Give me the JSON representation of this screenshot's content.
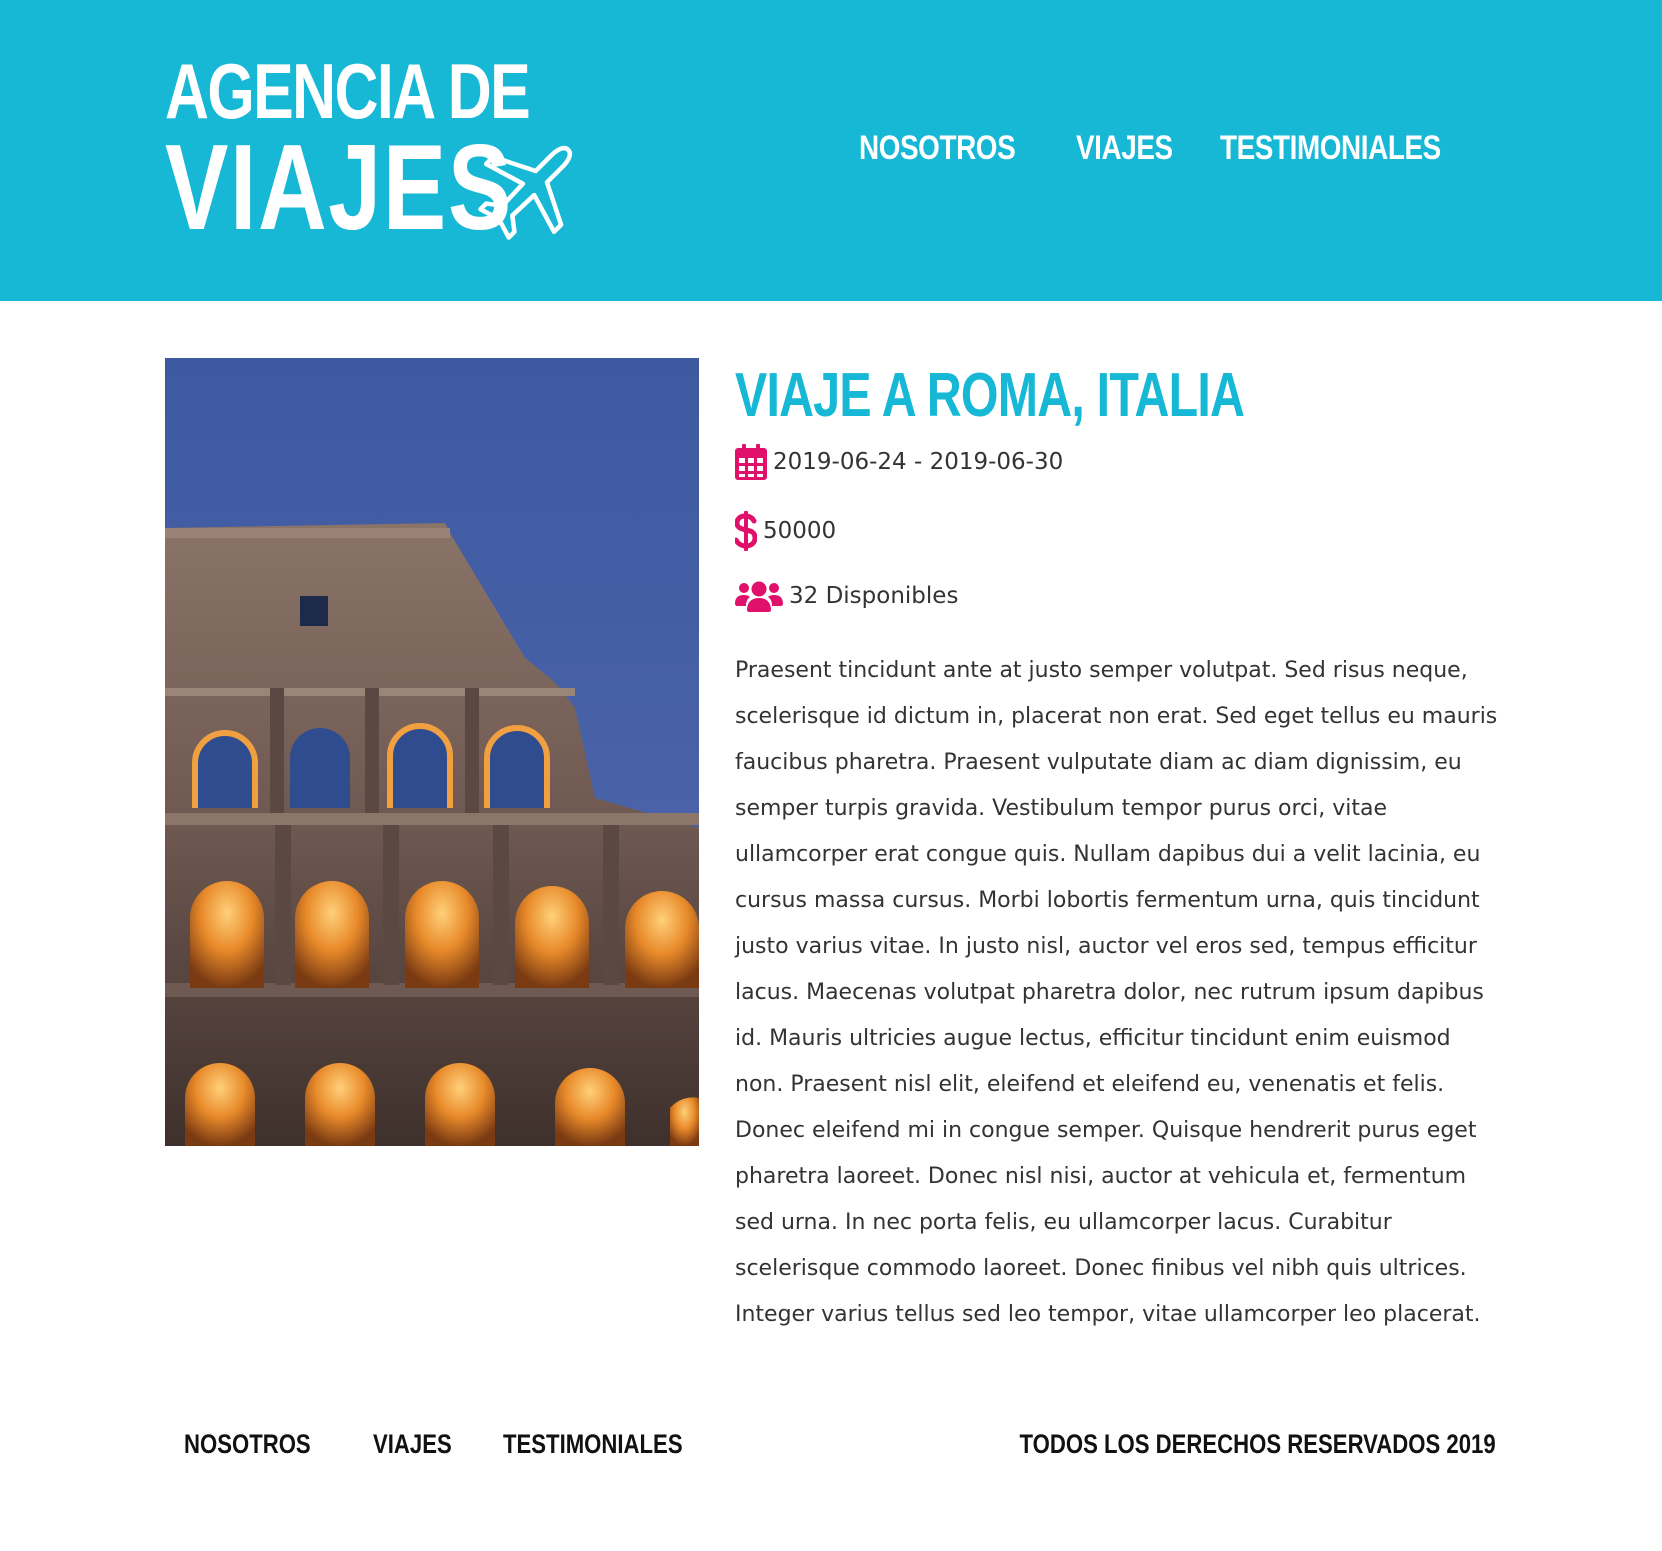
{
  "header": {
    "logo": {
      "line1": "AGENCIA DE",
      "line2": "VIAJES",
      "icon": "airplane-icon"
    },
    "nav": [
      "NOSOTROS",
      "VIAJES",
      "TESTIMONIALES"
    ],
    "background_color": "#16b8d6"
  },
  "trip": {
    "title": "VIAJE A ROMA, ITALIA",
    "dates": "2019-06-24 - 2019-06-30",
    "price": "50000",
    "availability": "32 Disponibles",
    "image_subject": "Colosseum at dusk",
    "icons": {
      "dates": "calendar-icon",
      "price": "dollar-icon",
      "availability": "users-icon"
    },
    "icon_color": "#e0116a",
    "description": "Praesent tincidunt ante at justo semper volutpat. Sed risus neque, scelerisque id dictum in, placerat non erat. Sed eget tellus eu mauris faucibus pharetra. Praesent vulputate diam ac diam dignissim, eu semper turpis gravida. Vestibulum tempor purus orci, vitae ullamcorper erat congue quis. Nullam dapibus dui a velit lacinia, eu cursus massa cursus. Morbi lobortis fermentum urna, quis tincidunt justo varius vitae. In justo nisl, auctor vel eros sed, tempus efficitur lacus. Maecenas volutpat pharetra dolor, nec rutrum ipsum dapibus id. Mauris ultricies augue lectus, efficitur tincidunt enim euismod non. Praesent nisl elit, eleifend et eleifend eu, venenatis et felis. Donec eleifend mi in congue semper. Quisque hendrerit purus eget pharetra laoreet. Donec nisl nisi, auctor at vehicula et, fermentum sed urna. In nec porta felis, eu ullamcorper lacus. Curabitur scelerisque commodo laoreet. Donec finibus vel nibh quis ultrices. Integer varius tellus sed leo tempor, vitae ullamcorper leo placerat."
  },
  "footer": {
    "nav": [
      "NOSOTROS",
      "VIAJES",
      "TESTIMONIALES"
    ],
    "copyright": "TODOS LOS DERECHOS RESERVADOS 2019"
  }
}
